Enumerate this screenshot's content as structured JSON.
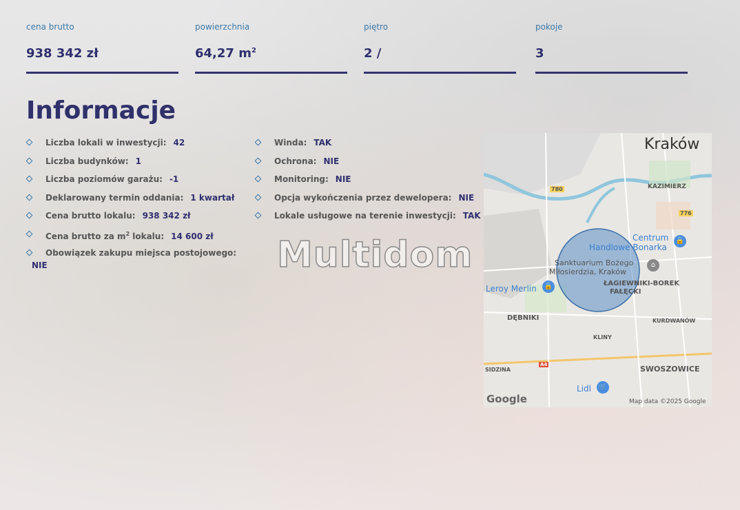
{
  "stats": [
    {
      "label": "cena brutto",
      "value": "938 342 zł",
      "sup": ""
    },
    {
      "label": "powierzchnia",
      "value": "64,27 m",
      "sup": "2"
    },
    {
      "label": "piętro",
      "value": "2 /",
      "sup": ""
    },
    {
      "label": "pokoje",
      "value": "3",
      "sup": ""
    }
  ],
  "heading": "Informacje",
  "left_list": [
    {
      "label": "Liczba lokali w inwestycji:",
      "value": "42"
    },
    {
      "label": "Liczba budynków:",
      "value": "1"
    },
    {
      "label": "Liczba poziomów garażu:",
      "value": "-1"
    },
    {
      "label": "Deklarowany termin oddania:",
      "value": "1 kwartał"
    },
    {
      "label": "Cena brutto lokalu:",
      "value": "938 342 zł"
    },
    {
      "label": "Cena brutto za m",
      "label_sup": "2",
      "label_suffix": " lokalu:",
      "value": "14 600 zł"
    },
    {
      "label": "Obowiązek zakupu miejsca postojowego:",
      "value": "NIE"
    }
  ],
  "right_list": [
    {
      "label": "Winda:",
      "value": "TAK"
    },
    {
      "label": "Ochrona:",
      "value": "NIE"
    },
    {
      "label": "Monitoring:",
      "value": "NIE"
    },
    {
      "label": "Opcja wykończenia przez dewelopera:",
      "value": "NIE"
    },
    {
      "label": "Lokale usługowe na terenie inwestycji:",
      "value": "TAK"
    }
  ],
  "watermark": "Multidom",
  "map": {
    "city": "Kraków",
    "labels": {
      "kazimierz": "KAZIMIERZ",
      "r780": "780",
      "r776": "776",
      "centrum": "Centrum",
      "handlowe": "Handlowe Bonarka",
      "sanktuarium1": "Sanktuarium Bożego",
      "sanktuarium2": "Miłosierdzia, Kraków",
      "leroy": "Leroy Merlin",
      "lagiewniki": "ŁAGIEWNIKI-BOREK",
      "falecki": "FAŁĘCKI",
      "debniki": "DĘBNIKI",
      "kurdwanow": "KURDWANÓW",
      "kliny": "KLINY",
      "a4": "A4",
      "sidzina": "SIDZINA",
      "swoszowice": "SWOSZOWICE",
      "lidl": "Lidl",
      "google": "Google",
      "attribution": "Map data ©2025 Google"
    }
  }
}
